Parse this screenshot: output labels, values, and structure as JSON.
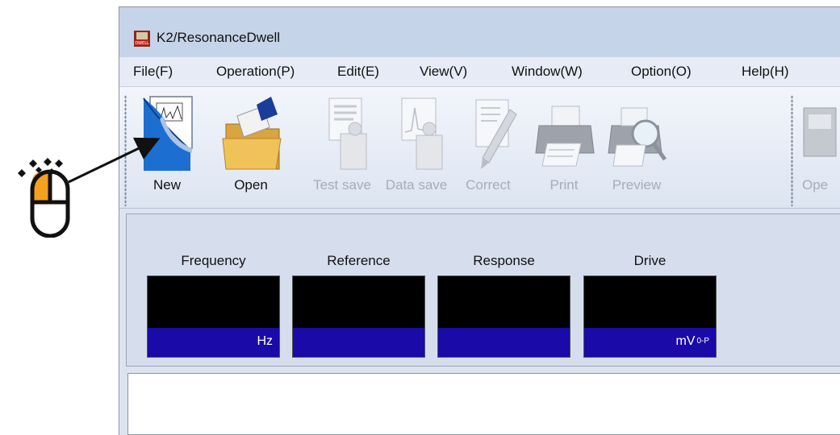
{
  "window": {
    "title": "K2/ResonanceDwell"
  },
  "menu": [
    "File(F)",
    "Operation(P)",
    "Edit(E)",
    "View(V)",
    "Window(W)",
    "Option(O)",
    "Help(H)"
  ],
  "toolbar": {
    "new_label": "New",
    "open_label": "Open",
    "test_save_label": "Test save",
    "data_save_label": "Data save",
    "correct_label": "Correct",
    "print_label": "Print",
    "preview_label": "Preview",
    "ope_label": "Ope"
  },
  "meters": {
    "frequency": {
      "label": "Frequency",
      "unit": "Hz"
    },
    "reference": {
      "label": "Reference",
      "unit": ""
    },
    "response": {
      "label": "Response",
      "unit": ""
    },
    "drive": {
      "label": "Drive",
      "unit": "mV",
      "unit_sub": "0-P"
    }
  },
  "colors": {
    "accent": "#f5a01e",
    "meter_bottom": "#1a0aa8",
    "meter_top": "#000000"
  },
  "icons": {
    "app": "app-icon",
    "new": "new-document-icon",
    "open": "open-folder-icon",
    "test_save": "test-save-icon",
    "data_save": "data-save-icon",
    "correct": "correct-pen-icon",
    "print": "printer-icon",
    "preview": "preview-icon",
    "mouse": "mouse-click-icon"
  }
}
